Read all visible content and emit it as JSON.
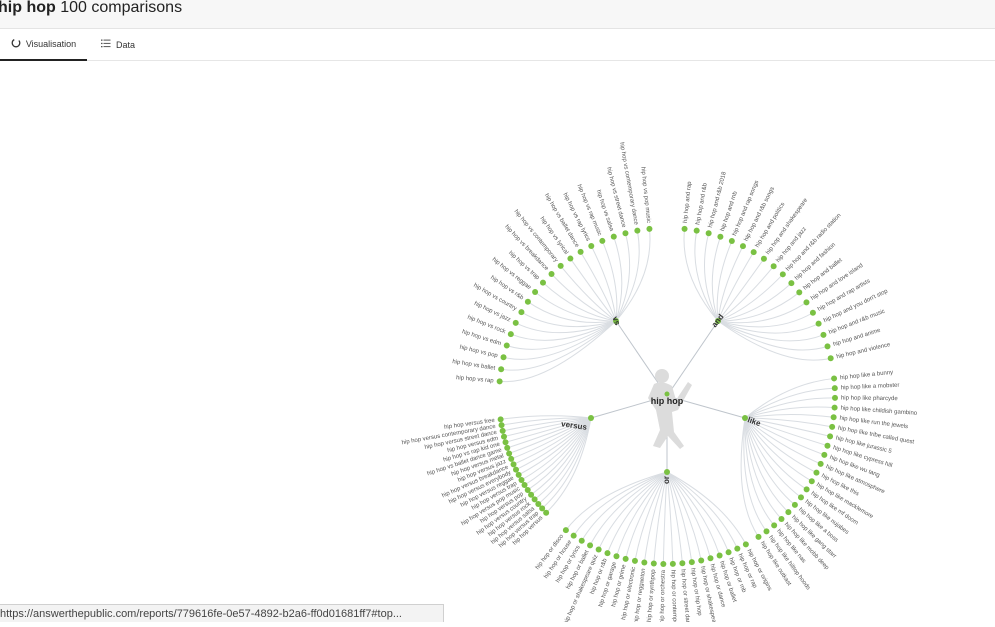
{
  "header": {
    "keyword": "hip hop",
    "suffix": "100 comparisons"
  },
  "tabs": [
    {
      "label": "Visualisation",
      "icon": "circle-loader-icon",
      "active": true
    },
    {
      "label": "Data",
      "icon": "list-icon",
      "active": false
    }
  ],
  "wheel": {
    "center_label": "hip hop",
    "colors": {
      "node": "#7ac143",
      "line": "#d9dde2",
      "text": "#555555",
      "branch_text": "#333333"
    },
    "branches": [
      {
        "label": "vs",
        "items": [
          "hip hop vs rap",
          "hip hop vs ballet",
          "hip hop vs pop",
          "hip hop vs edm",
          "hip hop vs rock",
          "hip hop vs jazz",
          "hip hop vs country",
          "hip hop vs r&b",
          "hip hop vs reggae",
          "hip hop vs trap",
          "hip hop vs breakdance",
          "hip hop vs contemporary",
          "hip hop vs lyrical",
          "hip hop vs ballet dance",
          "hip hop vs rap lyrics",
          "hip hop vs rap music",
          "hip hop vs salsa",
          "hip hop vs street dance",
          "hip hop vs contemporary dance",
          "hip hop vs pop music"
        ]
      },
      {
        "label": "and",
        "items": [
          "hip hop and rap",
          "hip hop and r&b",
          "hip hop and r&b 2018",
          "hip hop and rnb",
          "hip hop and rap songs",
          "hip hop and r&b songs",
          "hip hop and politics",
          "hip hop and shakespeare",
          "hip hop and jazz",
          "hip hop and r&b radio station",
          "hip hop and fashion",
          "hip hop and ballet",
          "hip hop and love island",
          "hip hop and rap artists",
          "hip hop and you don't stop",
          "hip hop and r&b music",
          "hip hop and anime",
          "hip hop and violence"
        ]
      },
      {
        "label": "like",
        "items": [
          "hip hop like a bunny",
          "hip hop like a mobster",
          "hip hop like pharcyde",
          "hip hop like childish gambino",
          "hip hop like run the jewels",
          "hip hop like tribe called quest",
          "hip hop like jurassic 5",
          "hip hop like cypress hill",
          "hip hop like wu tang",
          "hip hop like atmosphere",
          "hip hop like this",
          "hip hop like macklemore",
          "hip hop like mf doom",
          "hip hop like nujabes",
          "hip hop like a boss",
          "hip hop like gang starr",
          "hip hop like mobb deep",
          "hip hop like nas",
          "hip hop like hilltop hoods",
          "hip hop like outkast"
        ]
      },
      {
        "label": "or",
        "items": [
          "hip hop or origins",
          "hip hop or rap",
          "hip hop or rnb",
          "hip hop or ballet",
          "hip hop or dance",
          "hip hop or shakespeare",
          "hip hop or hip hop",
          "hip hop or street dance",
          "hip hop or contemporary",
          "hip hop or orchestra",
          "hip hop or synthpop",
          "hip hop or reggaeton",
          "hip hop or electronic",
          "hip hop or grime",
          "hip hop or garage",
          "hip hop or r&b",
          "hip hop or shakespeare quiz",
          "hip hop or ballet",
          "hip hop or lyrics",
          "hip hop or house",
          "hip hop or disco"
        ]
      },
      {
        "label": "versus",
        "items": [
          "hip hop versus",
          "hip hop versus trap",
          "hip hop versus salsa",
          "hip hop versus rock",
          "hip hop versus country",
          "hip hop versus pop",
          "hip hop versus pop music",
          "hip hop versus trap",
          "hip hop versus reggae",
          "hip hop versus everybody",
          "hip hop versus breakdance",
          "hip hop versus jazz",
          "hip hop versus metal",
          "hip hop vs ballet dance game",
          "hip hop vs rap kid one",
          "hip hop versus edm",
          "hip hop versus street dance",
          "hip hop versus contemporary dance",
          "hip hop versus free"
        ]
      }
    ]
  },
  "status_bar": {
    "url": "https://answerthepublic.com/reports/779616fe-0e57-4892-b2a6-ff0d01681ff7#top..."
  }
}
